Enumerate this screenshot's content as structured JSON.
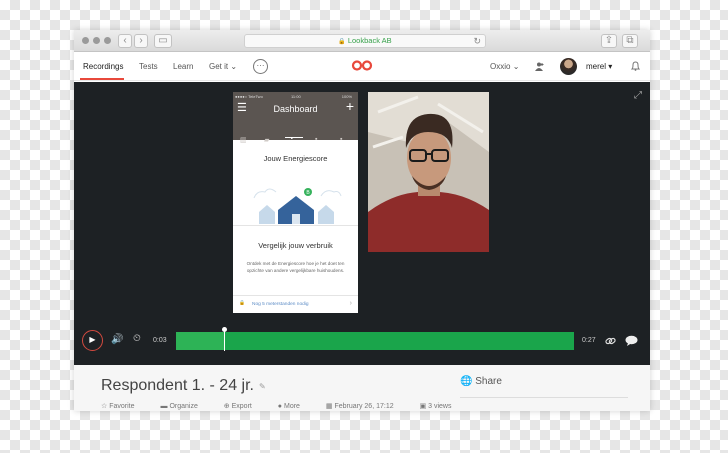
{
  "browser": {
    "url_text": "Lookback AB",
    "lock_icon": "lock-icon",
    "buttons": [
      "back-icon",
      "forward-icon",
      "sidebar-icon",
      "share-icon",
      "tabs-icon"
    ]
  },
  "nav": {
    "items": [
      {
        "label": "Recordings",
        "active": true
      },
      {
        "label": "Tests"
      },
      {
        "label": "Learn"
      },
      {
        "label": "Get it"
      }
    ],
    "get_it_chevron": "⌄",
    "more_icon": "···",
    "org_name": "Oxxio",
    "org_chevron": "⌄",
    "user_name": "merel",
    "user_chevron": "▾"
  },
  "phone": {
    "status_carrier": "●●●●○ TeleTwo",
    "status_time": "11:00",
    "status_battery": "100%",
    "title": "Dashboard",
    "card_title": "Jouw Energiescore",
    "subheading": "Vergelijk jouw verbruik",
    "body": "Ontdek met de Energiescore hoe je het doet ten opzichte van andere vergelijkbare huishoudens.",
    "footer": "Nog 5 meterstanden nodig"
  },
  "player": {
    "current_time": "0:03",
    "total_time": "0:27",
    "progress": 0.12
  },
  "recording": {
    "title": "Respondent 1. - 24 jr.",
    "share_label": "Share",
    "actions": [
      "Favorite",
      "Organize",
      "Export",
      "More"
    ],
    "date": "February 26, 17:12",
    "views": "3 views"
  },
  "colors": {
    "accent": "#e8483b",
    "timeline": "#1aa54b",
    "player_bg": "#1d2124",
    "url_green": "#37a14b"
  }
}
